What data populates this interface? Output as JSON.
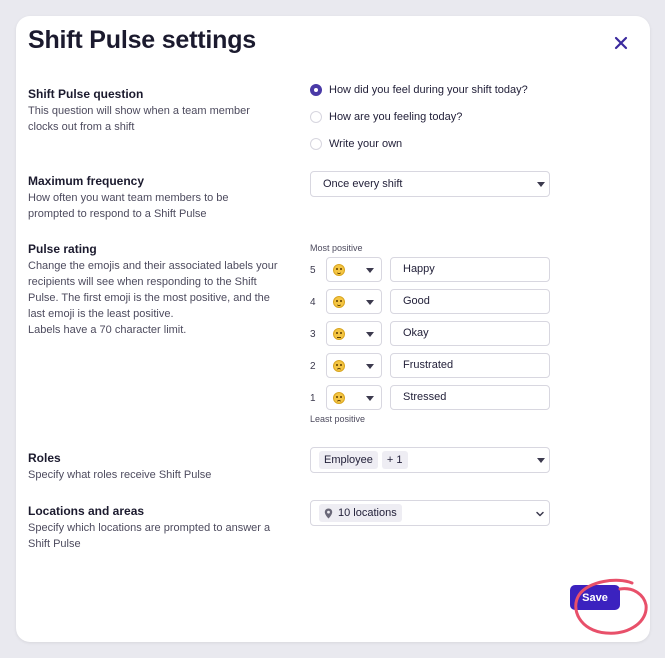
{
  "modal": {
    "title": "Shift Pulse settings"
  },
  "question": {
    "title": "Shift Pulse question",
    "description": "This question will show when a team member clocks out from a shift",
    "options": [
      {
        "label": "How did you feel during your shift today?",
        "selected": true
      },
      {
        "label": "How are you feeling today?",
        "selected": false
      },
      {
        "label": "Write your own",
        "selected": false
      }
    ]
  },
  "frequency": {
    "title": "Maximum frequency",
    "description": "How often you want team members to be prompted to respond to a Shift Pulse",
    "selected": "Once every shift"
  },
  "rating": {
    "title": "Pulse rating",
    "description": "Change the emojis and their associated labels your recipients will see when responding to the Shift Pulse. The first emoji is the most positive, and the last emoji is the least positive.",
    "limit_note": "Labels have a 70 character limit.",
    "top_label": "Most positive",
    "bottom_label": "Least positive",
    "items": [
      {
        "number": "5",
        "label": "Happy",
        "emoji": "grinning-face-icon"
      },
      {
        "number": "4",
        "label": "Good",
        "emoji": "smiling-face-icon"
      },
      {
        "number": "3",
        "label": "Okay",
        "emoji": "neutral-face-icon"
      },
      {
        "number": "2",
        "label": "Frustrated",
        "emoji": "confused-face-icon"
      },
      {
        "number": "1",
        "label": "Stressed",
        "emoji": "sad-face-icon"
      }
    ]
  },
  "roles": {
    "title": "Roles",
    "description": "Specify what roles receive Shift Pulse",
    "tag": "Employee",
    "more": "+ 1"
  },
  "locations": {
    "title": "Locations and areas",
    "description": "Specify which locations are prompted to answer a Shift Pulse",
    "tag": "10 locations"
  },
  "footer": {
    "save_label": "Save"
  },
  "colors": {
    "primary": "#3b22bf",
    "annotation": "#e8506a"
  }
}
